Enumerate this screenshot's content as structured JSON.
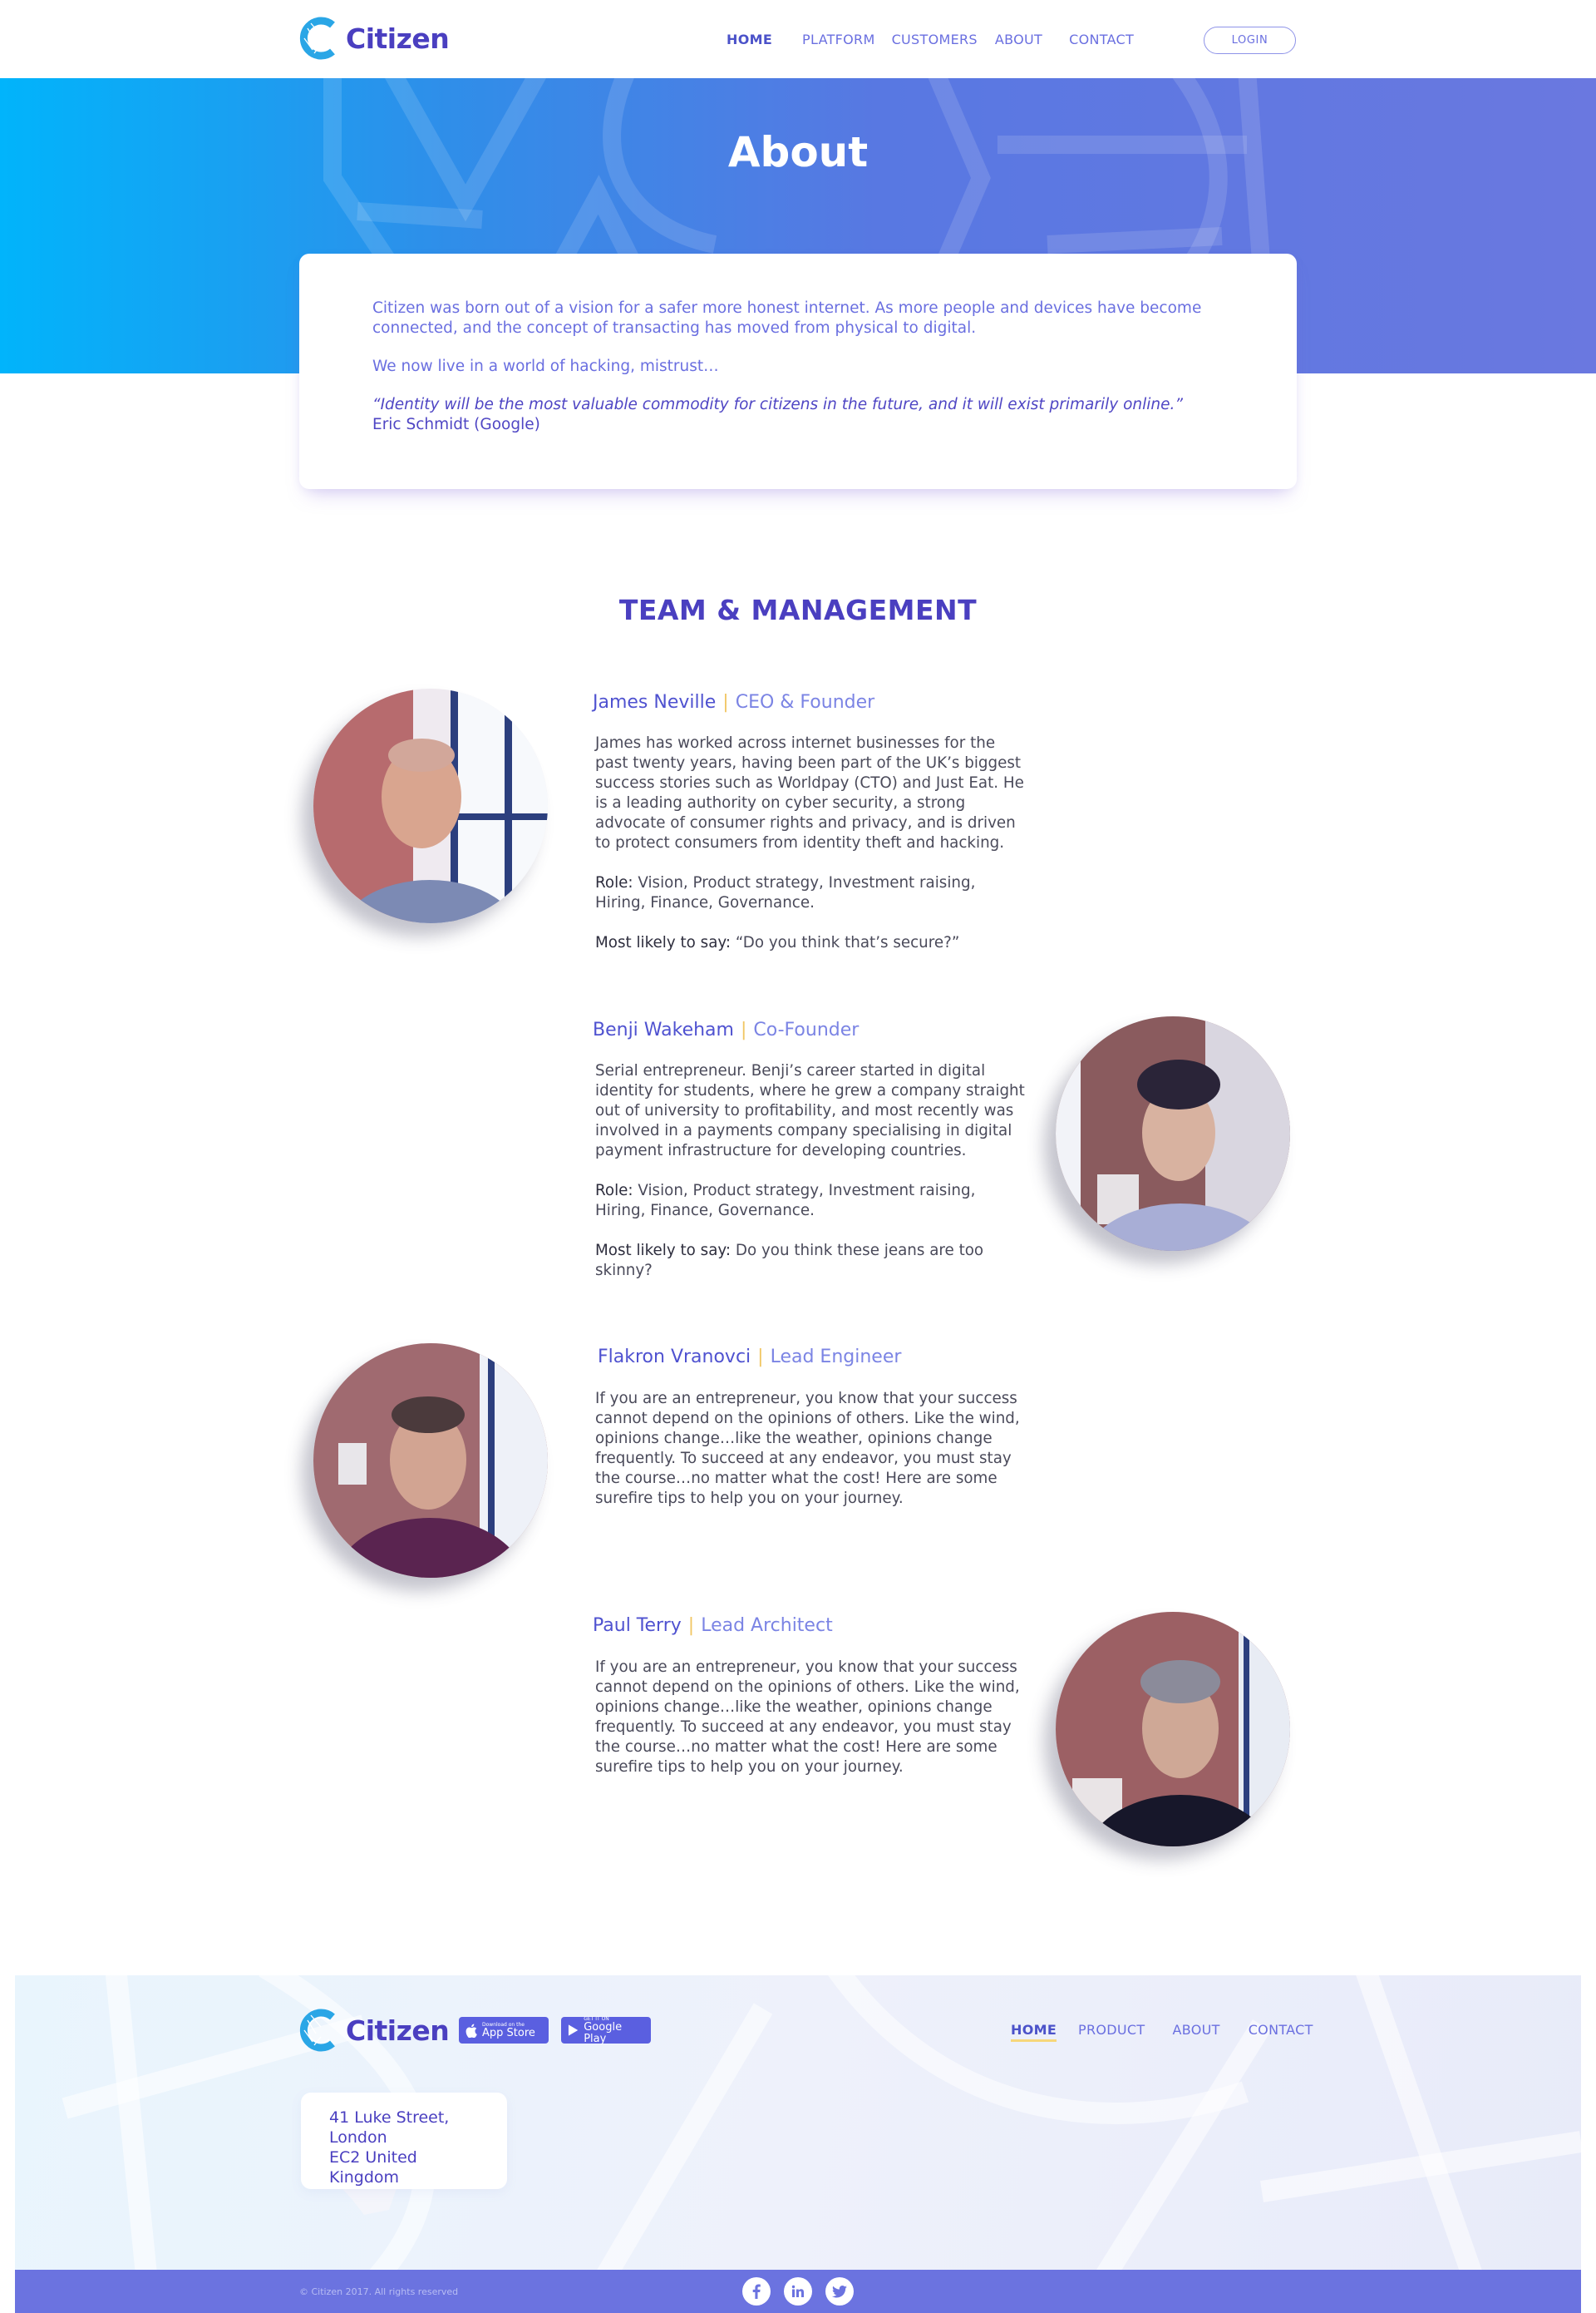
{
  "brand": {
    "name": "Citizen"
  },
  "nav": {
    "items": [
      {
        "label": "HOME",
        "active": true
      },
      {
        "label": "PLATFORM"
      },
      {
        "label": "CUSTOMERS"
      },
      {
        "label": "ABOUT"
      },
      {
        "label": "CONTACT"
      }
    ],
    "login_label": "LOGIN"
  },
  "hero": {
    "title": "About"
  },
  "about": {
    "paragraph1": "Citizen was born out of a vision for a safer more honest internet. As more people and devices have become connected, and the concept of transacting has moved from physical to digital.",
    "paragraph2": "We now live in a world of hacking, mistrust…",
    "quote": "“Identity will be the most valuable commodity for citizens in the future, and it will exist primarily online.”",
    "quote_author": "Eric Schmidt (Google)"
  },
  "team": {
    "heading": "TEAM & MANAGEMENT",
    "members": [
      {
        "name": "James Neville",
        "separator": "|",
        "role": "CEO & Founder",
        "bio": "James has worked across internet businesses for the past twenty years, having been part of the UK’s biggest success stories such as Worldpay (CTO) and Just Eat. He is a leading authority on cyber security, a strong advocate of consumer rights and privacy, and is driven to protect consumers from identity theft and hacking.",
        "role_label": "Role:",
        "role_text": "Vision, Product strategy, Investment raising, Hiring, Finance, Governance.",
        "say_label": "Most likely to say:",
        "say_text": "“Do you think that’s secure?”"
      },
      {
        "name": "Benji Wakeham",
        "separator": "|",
        "role": "Co-Founder",
        "bio": "Serial entrepreneur. Benji’s career started in digital identity for students, where he grew a company straight out of university to profitability, and most recently was involved in a payments company specialising in digital payment infrastructure for developing countries.",
        "role_label": "Role:",
        "role_text": "Vision, Product strategy, Investment raising, Hiring, Finance, Governance.",
        "say_label": "Most likely to say:",
        "say_text": "Do you think these jeans are too skinny?"
      },
      {
        "name": "Flakron Vranovci",
        "separator": "|",
        "role": "Lead Engineer",
        "bio": "If you are an entrepreneur, you know that your success cannot depend on the opinions of others. Like the wind, opinions change…like the weather, opinions change frequently. To succeed at any endeavor, you must stay the course…no matter what the cost! Here are some surefire tips to help you on your journey."
      },
      {
        "name": "Paul Terry",
        "separator": "|",
        "role": "Lead Architect",
        "bio": "If you are an entrepreneur, you know that your success cannot depend on the opinions of others. Like the wind, opinions change…like the weather, opinions change frequently. To succeed at any endeavor, you must stay the course…no matter what the cost! Here are some surefire tips to help you on your journey."
      }
    ]
  },
  "footer": {
    "app_store": {
      "small": "Download on the",
      "big": "App Store"
    },
    "google_play": {
      "small": "GET IT ON",
      "big": "Google Play"
    },
    "nav": [
      {
        "label": "HOME",
        "active": true
      },
      {
        "label": "PRODUCT"
      },
      {
        "label": "ABOUT"
      },
      {
        "label": "CONTACT"
      }
    ],
    "address": {
      "line1": "41 Luke Street,",
      "line2": "London",
      "line3": "EC2 United Kingdom"
    },
    "copyright": "© Citizen 2017. All rights reserved",
    "social": [
      "facebook-icon",
      "linkedin-icon",
      "twitter-icon"
    ]
  },
  "colors": {
    "brand": "#4a3fc0",
    "link": "#6a6fe0",
    "hero_start": "#01b4fb",
    "hero_end": "#6a78e0",
    "accent_yellow": "#f1c663",
    "bottom_bar": "#6b73e0"
  }
}
